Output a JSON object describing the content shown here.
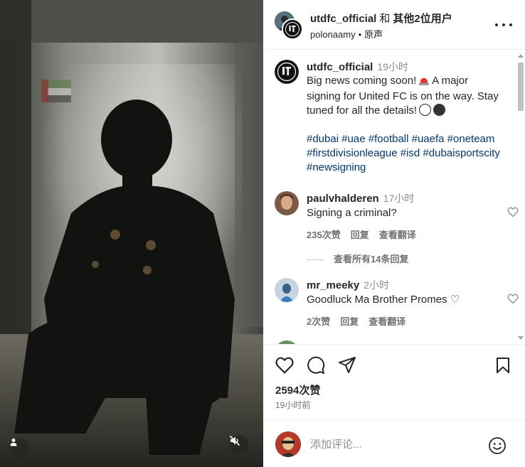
{
  "header": {
    "account": "utdfc_official",
    "joiner": "和",
    "collaborators": "其他2位用户",
    "location": "polonaamy",
    "separator": "•",
    "audio": "原声"
  },
  "caption": {
    "username": "utdfc_official",
    "time": "19小时",
    "text_part1": "Big news coming soon!",
    "text_part2": "A major signing for United FC is on the way. Stay tuned for all the details!",
    "hashtags": "#dubai #uae #football #uaefa #oneteam #firstdivisionleague #isd #dubaisportscity #newsigning"
  },
  "comments": [
    {
      "username": "paulvhalderen",
      "time": "17小时",
      "text": "Signing a criminal?",
      "likes": "235次赞",
      "reply": "回复",
      "translate": "查看翻译"
    },
    {
      "username": "mr_meeky",
      "time": "2小时",
      "text": "Goodluck Ma Brother Promes ♡",
      "likes": "2次赞",
      "reply": "回复",
      "translate": "查看翻译"
    }
  ],
  "view_replies": "查看所有14条回复",
  "likes_count": "2594次赞",
  "posted_time": "19小时前",
  "comment_placeholder": "添加评论...",
  "icons": {
    "like": "heart-icon",
    "comment": "speech-bubble-icon",
    "share": "paper-plane-icon",
    "save": "bookmark-icon",
    "emoji": "smiley-icon",
    "more": "more-dots-icon",
    "mute": "speaker-muted-icon",
    "tag": "person-icon"
  }
}
